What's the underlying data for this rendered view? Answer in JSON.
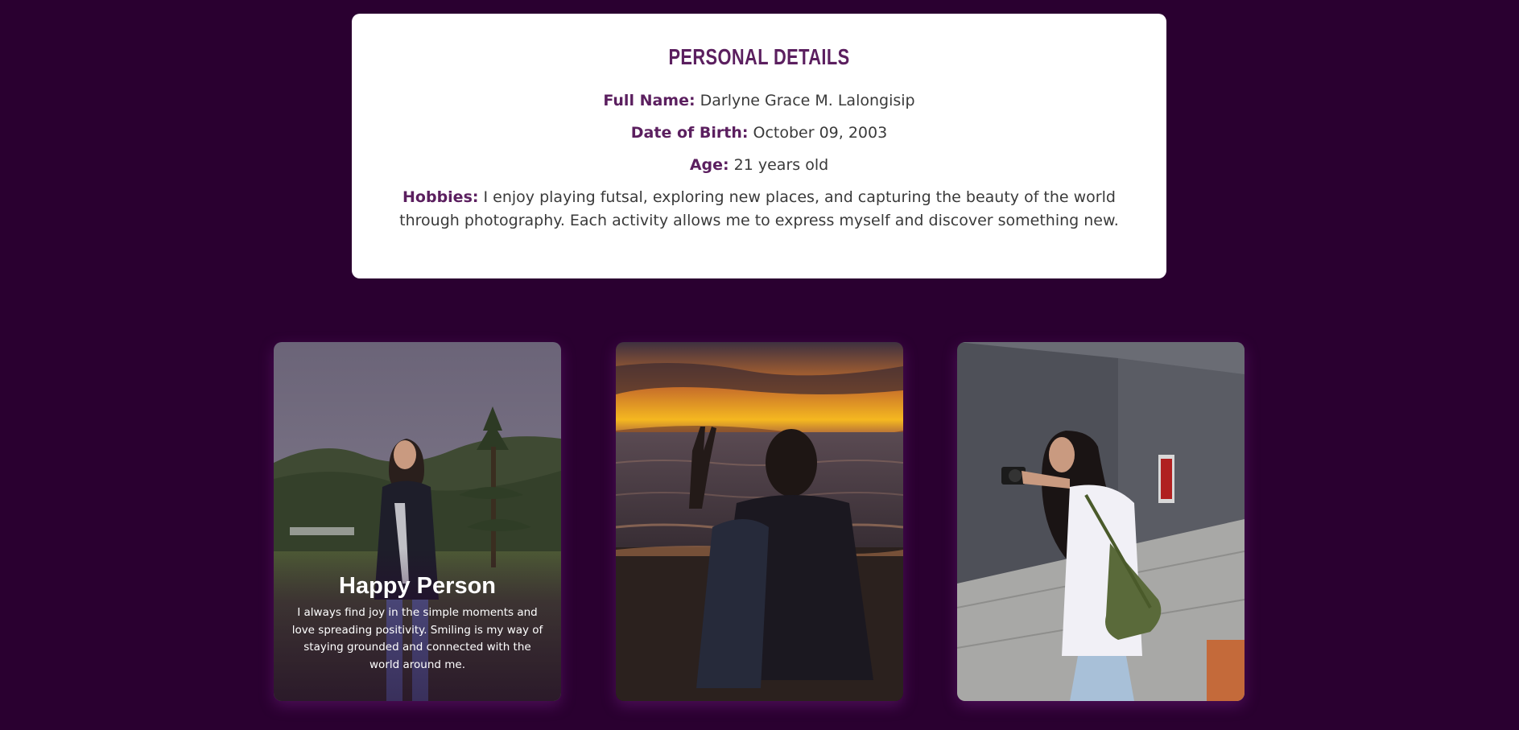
{
  "personal_details": {
    "title": "Personal Details",
    "full_name_label": "Full Name:",
    "full_name": "Darlyne Grace M. Lalongisip",
    "dob_label": "Date of Birth:",
    "dob": "October 09, 2003",
    "age_label": "Age:",
    "age": "21 years old",
    "hobbies_label": "Hobbies:",
    "hobbies": "I enjoy playing futsal, exploring new places, and capturing the beauty of the world through photography. Each activity allows me to express myself and discover something new."
  },
  "gallery": {
    "cards": [
      {
        "title": "Happy Person",
        "text": "I always find joy in the simple moments and love spreading positivity. Smiling is my way of staying grounded and connected with the world around me."
      },
      {},
      {}
    ]
  },
  "colors": {
    "page_background": "#2a0030",
    "card_background": "#ffffff",
    "accent": "#5b1f5f",
    "body_text": "#3a3a3a"
  }
}
